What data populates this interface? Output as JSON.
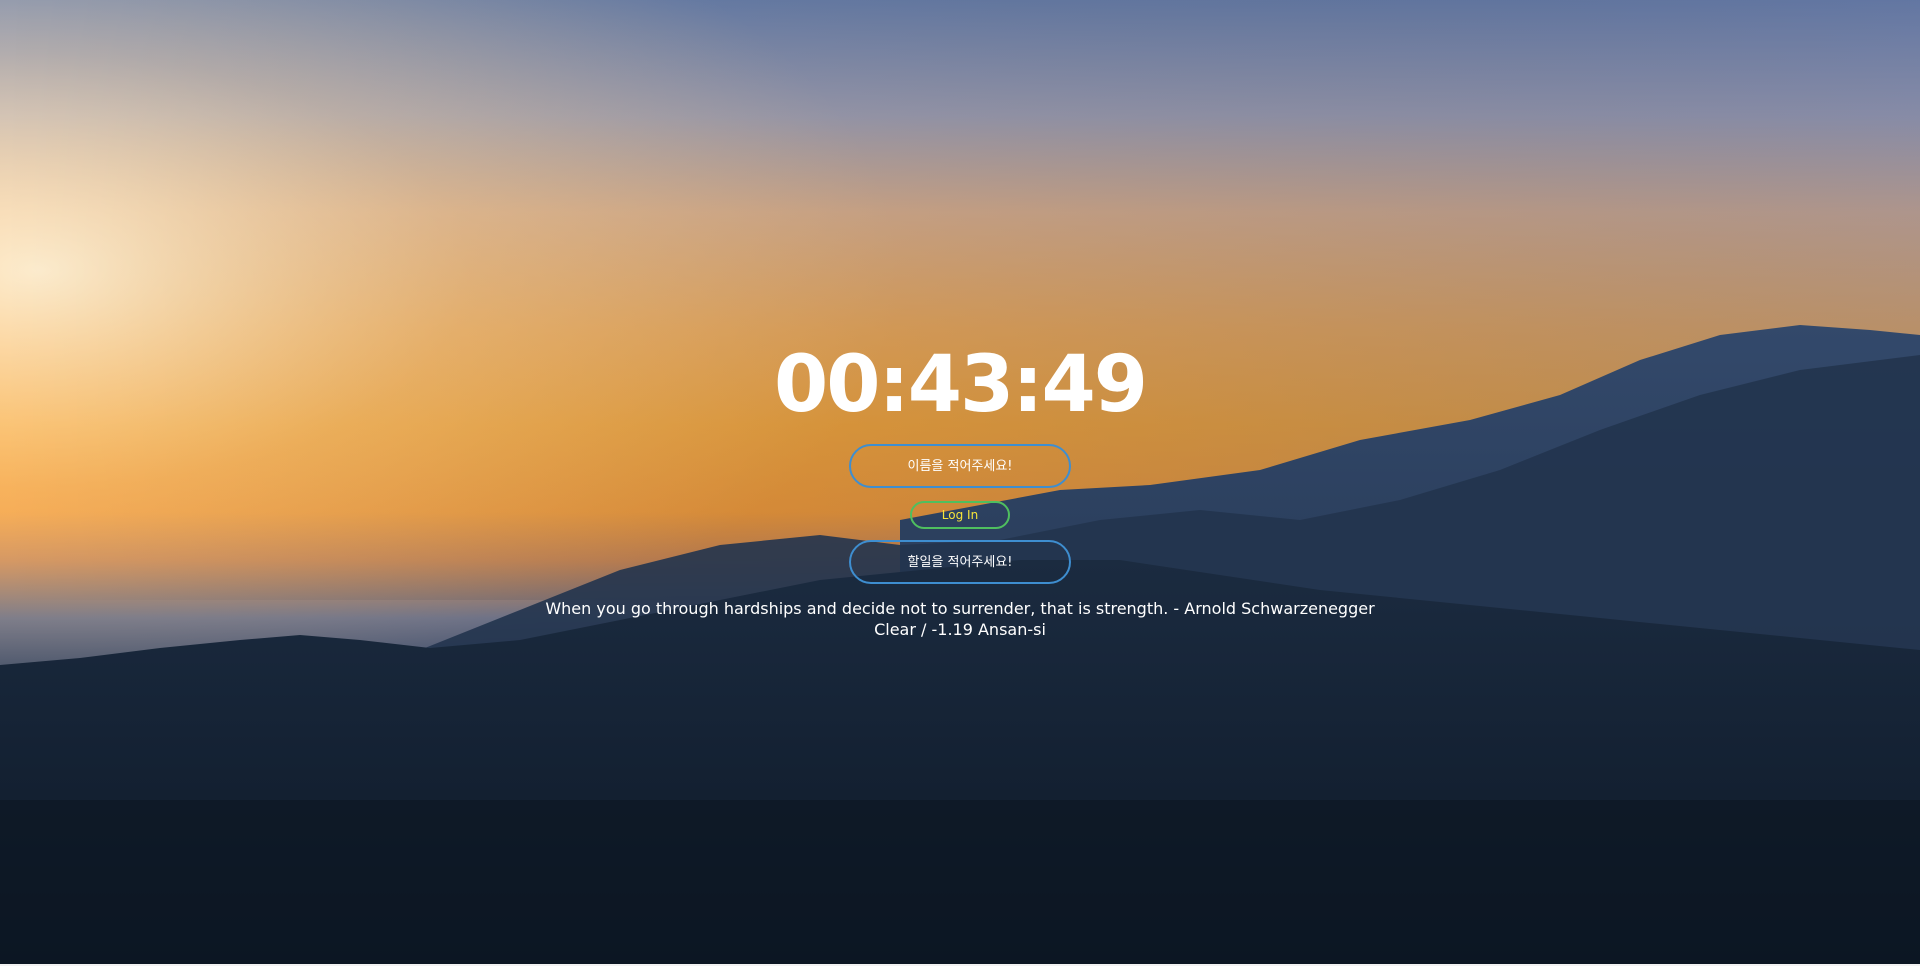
{
  "clock": {
    "time": "00:43:49"
  },
  "login": {
    "name_placeholder": "이름을 적어주세요!",
    "button_label": "Log In"
  },
  "todo": {
    "placeholder": "할일을 적어주세요!"
  },
  "quote": {
    "text": "When you go through hardships and decide not to surrender, that is strength. - Arnold Schwarzenegger"
  },
  "weather": {
    "text": "Clear / -1.19 Ansan-si"
  },
  "colors": {
    "input_border": "#3e8ed0",
    "login_border": "#4fbf5f",
    "login_text": "#f6e43a"
  }
}
